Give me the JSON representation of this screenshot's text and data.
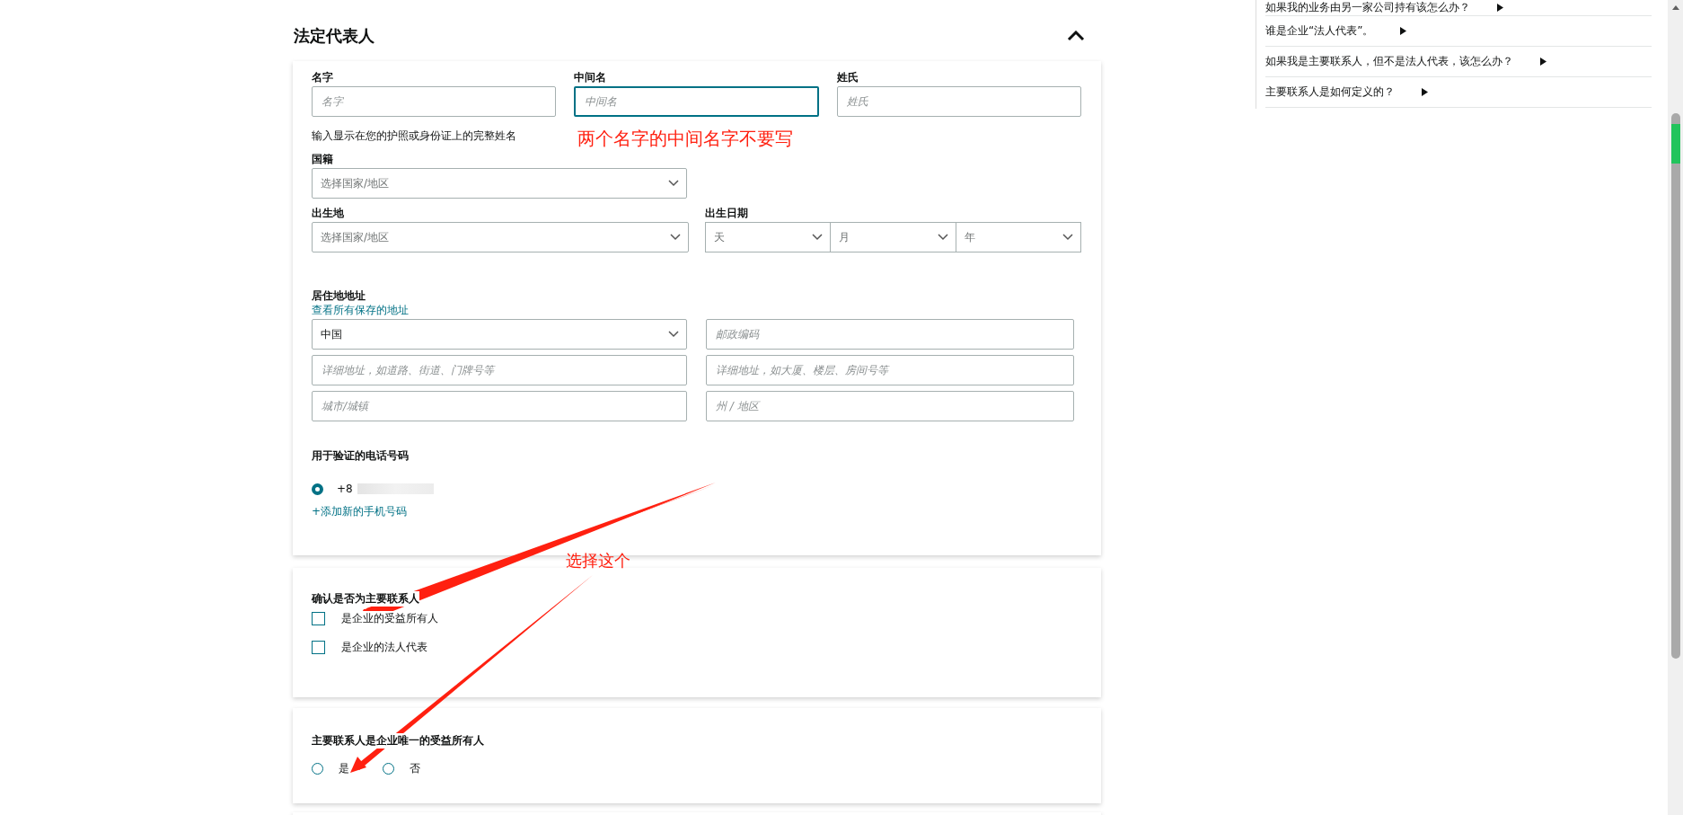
{
  "section": {
    "title": "法定代表人",
    "expanded": true
  },
  "name_fields": [
    {
      "label": "名字",
      "placeholder": "名字",
      "focused": false
    },
    {
      "label": "中间名",
      "placeholder": "中间名",
      "focused": true
    },
    {
      "label": "姓氏",
      "placeholder": "姓氏",
      "focused": false
    }
  ],
  "name_hint": "输入显示在您的护照或身份证上的完整姓名",
  "nationality": {
    "label": "国籍",
    "placeholder": "选择国家/地区"
  },
  "birth_place": {
    "label": "出生地",
    "placeholder": "选择国家/地区"
  },
  "birth_date": {
    "label": "出生日期",
    "parts": [
      "天",
      "月",
      "年"
    ]
  },
  "address": {
    "label": "居住地地址",
    "link": "查看所有保存的地址",
    "country": "中国",
    "fields": [
      {
        "placeholder": "邮政编码"
      },
      {
        "placeholder": "详细地址，如道路、街道、门牌号等"
      },
      {
        "placeholder": "详细地址，如大厦、楼层、房间号等"
      },
      {
        "placeholder": "城市/城镇"
      },
      {
        "placeholder": "州 / 地区"
      }
    ]
  },
  "phone": {
    "label": "用于验证的电话号码",
    "options": [
      {
        "number": "+8",
        "selected": true
      }
    ],
    "add_link": "+添加新的手机号码"
  },
  "contact_role": {
    "title": "确认是否为主要联系人",
    "options": [
      {
        "label": "是企业的受益所有人",
        "checked": false
      },
      {
        "label": "是企业的法人代表",
        "checked": false
      }
    ]
  },
  "sole_owner": {
    "title": "主要联系人是企业唯一的受益所有人",
    "options": [
      {
        "label": "是",
        "selected": false
      },
      {
        "label": "否",
        "selected": false
      }
    ]
  },
  "faq": [
    {
      "text": "如果我的业务由另一家公司持有该怎么办？"
    },
    {
      "text": "谁是企业“法人代表”。"
    },
    {
      "text": "如果我是主要联系人，但不是法人代表，该怎么办？"
    },
    {
      "text": "主要联系人是如何定义的？"
    }
  ],
  "annotations": [
    {
      "text": "两个名字的中间名字不要写"
    },
    {
      "text": "选择这个"
    }
  ]
}
